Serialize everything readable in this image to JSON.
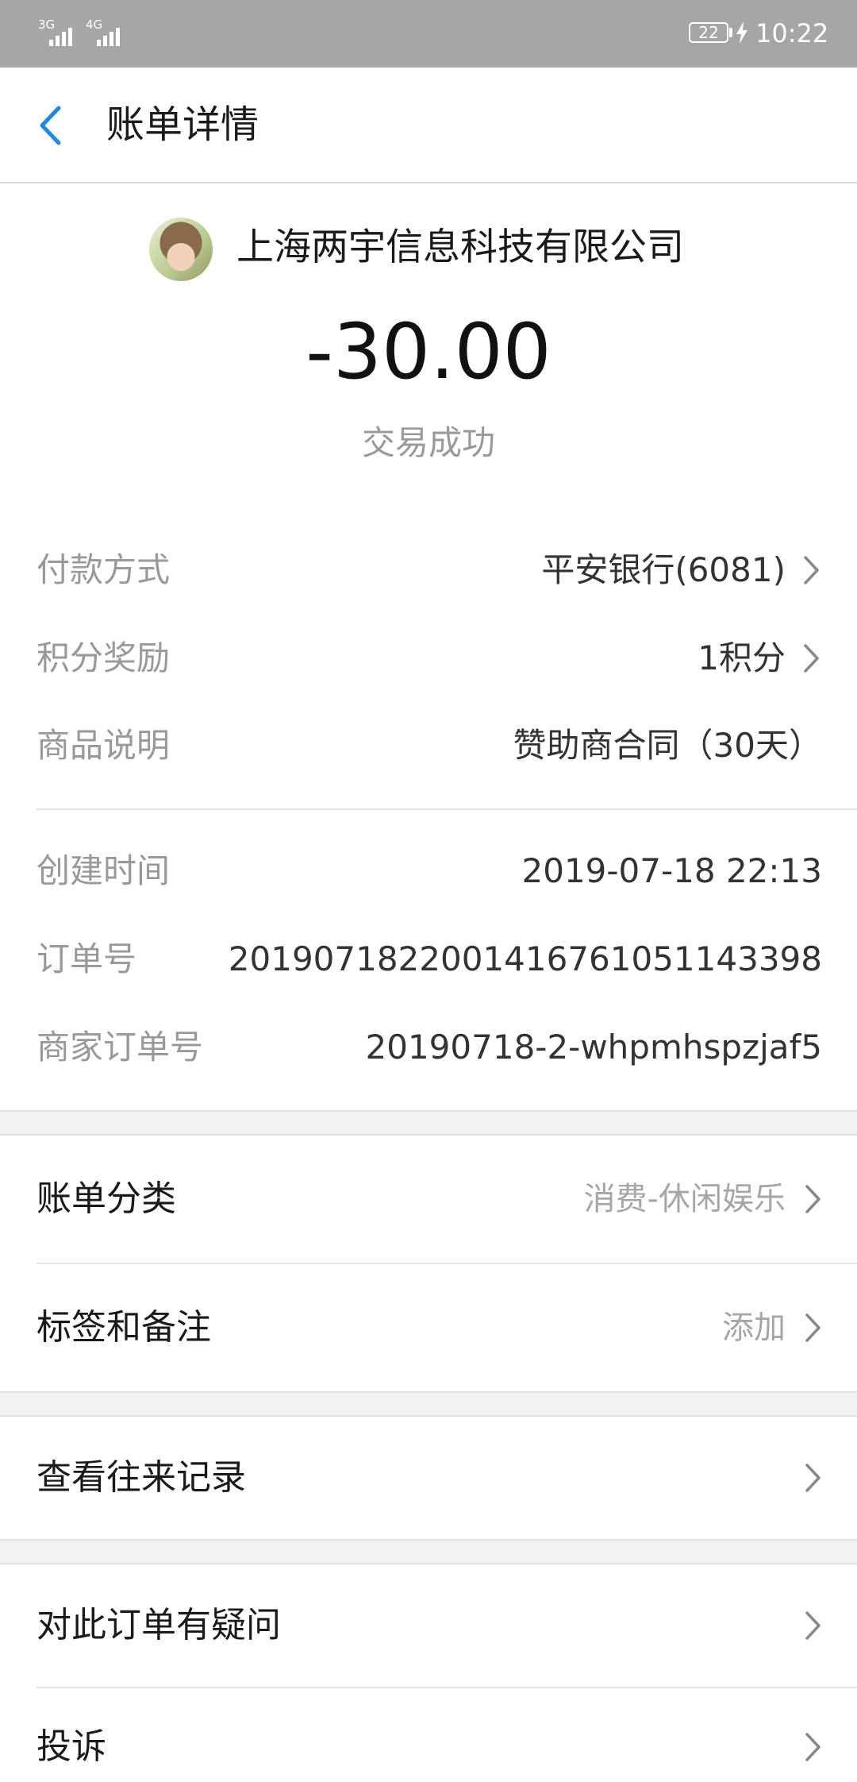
{
  "status_bar": {
    "signal_1": "3G",
    "signal_2": "4G",
    "battery": "22",
    "time": "10:22"
  },
  "header": {
    "back_icon": "chevron-left-icon",
    "title": "账单详情"
  },
  "merchant": {
    "name": "上海两宇信息科技有限公司",
    "amount": "-30.00",
    "status": "交易成功"
  },
  "details": {
    "payment_method": {
      "label": "付款方式",
      "value": "平安银行(6081)"
    },
    "points_reward": {
      "label": "积分奖励",
      "value": "1积分"
    },
    "product_desc": {
      "label": "商品说明",
      "value": "赞助商合同（30天）"
    },
    "created_time": {
      "label": "创建时间",
      "value": "2019-07-18 22:13"
    },
    "order_no": {
      "label": "订单号",
      "value": "2019071822001416761051143398"
    },
    "merchant_order_no": {
      "label": "商家订单号",
      "value": "20190718-2-whpmhspzjaf5"
    }
  },
  "actions": {
    "category": {
      "label": "账单分类",
      "value": "消费-休闲娱乐"
    },
    "tags_notes": {
      "label": "标签和备注",
      "value": "添加"
    },
    "history": {
      "label": "查看往来记录"
    },
    "question": {
      "label": "对此订单有疑问"
    },
    "complaint": {
      "label": "投诉"
    }
  },
  "colors": {
    "accent": "#1e88e5",
    "status_bar": "#a6a6a6",
    "label_gray": "#999999",
    "separator_bg": "#f2f2f2"
  }
}
